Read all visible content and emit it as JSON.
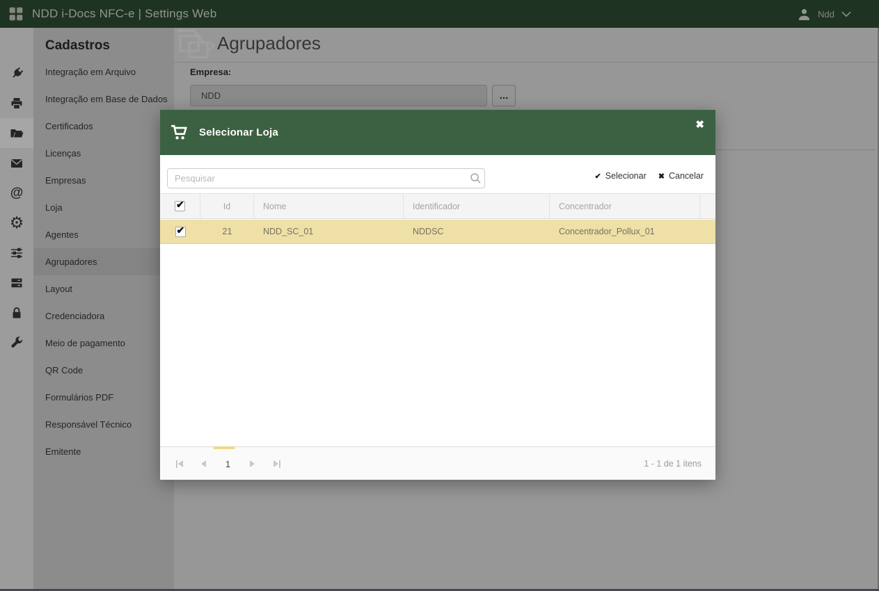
{
  "topbar": {
    "title": "NDD i-Docs NFC-e | Settings Web",
    "user_name": "Ndd"
  },
  "rail": {
    "icons": [
      "plug",
      "printer",
      "folder-open",
      "mail",
      "at-sign",
      "gear",
      "sliders",
      "server",
      "lock",
      "wrench"
    ],
    "active_icon": "folder-open",
    "at_glyph": "@",
    "gear_glyph": "⚙"
  },
  "sidebar": {
    "heading": "Cadastros",
    "items": [
      "Integração em Arquivo",
      "Integração em Base de Dados",
      "Certificados",
      "Licenças",
      "Empresas",
      "Loja",
      "Agentes",
      "Agrupadores",
      "Layout",
      "Credenciadora",
      "Meio de pagamento",
      "QR Code",
      "Formulários PDF",
      "Responsável Técnico",
      "Emitente"
    ],
    "selected_item": "Agrupadores"
  },
  "main": {
    "page_title": "Agrupadores",
    "form": {
      "empresa_label": "Empresa:",
      "empresa_value": "NDD",
      "browse_button_label": "..."
    }
  },
  "modal": {
    "title": "Selecionar Loja",
    "icons": {
      "header": "cart",
      "close_glyph": "✖",
      "select_glyph": "✔",
      "cancel_glyph": "✖",
      "checkbox_glyph": "✔"
    },
    "search": {
      "placeholder": "Pesquisar"
    },
    "actions": {
      "select_label": "Selecionar",
      "cancel_label": "Cancelar"
    },
    "table": {
      "columns": [
        "Id",
        "Nome",
        "Identificador",
        "Concentrador"
      ],
      "rows": [
        {
          "checked": true,
          "id": "21",
          "nome": "NDD_SC_01",
          "identificador": "NDDSC",
          "concentrador": "Concentrador_Pollux_01"
        }
      ]
    },
    "pager": {
      "current_page": "1",
      "summary": "1 - 1 de 1 itens"
    }
  },
  "colors": {
    "topbar_green": "#2e4f34",
    "header_green": "#3c6142",
    "row_highlight": "#eee0a6",
    "pager_indicator": "#ecd88e"
  }
}
